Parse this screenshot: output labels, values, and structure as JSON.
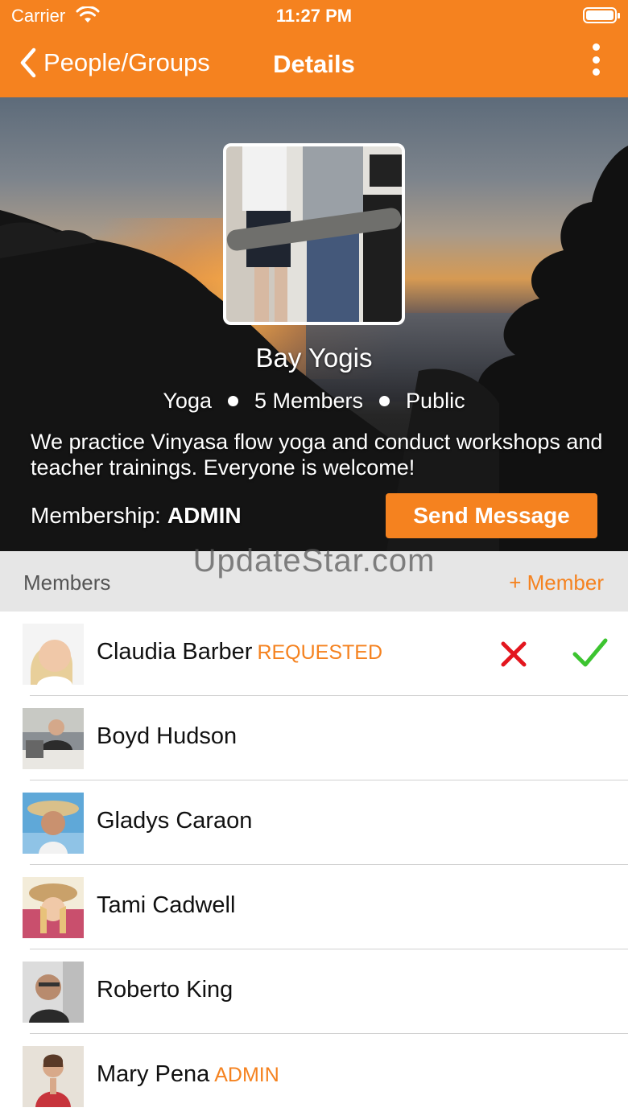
{
  "status_bar": {
    "carrier": "Carrier",
    "time": "11:27 PM",
    "wifi_icon": "wifi-icon",
    "battery_icon": "battery-icon"
  },
  "nav": {
    "back_label": "People/Groups",
    "title": "Details",
    "menu_icon": "more-vertical-icon"
  },
  "group": {
    "name": "Bay Yogis",
    "category": "Yoga",
    "members_count": "5 Members",
    "visibility": "Public",
    "description": "We practice Vinyasa flow yoga and conduct workshops and teacher trainings. Everyone is welcome!",
    "membership_label": "Membership:",
    "membership_role": "ADMIN",
    "send_message_label": "Send Message"
  },
  "members_section": {
    "title": "Members",
    "add_label": "+ Member"
  },
  "watermark": "UpdateStar.com",
  "members": [
    {
      "name": "Claudia Barber",
      "badge": "REQUESTED",
      "reject_icon": "x-icon",
      "accept_icon": "check-icon"
    },
    {
      "name": "Boyd Hudson",
      "badge": ""
    },
    {
      "name": "Gladys Caraon",
      "badge": ""
    },
    {
      "name": "Tami Cadwell",
      "badge": ""
    },
    {
      "name": "Roberto King",
      "badge": ""
    },
    {
      "name": "Mary Pena",
      "badge": "ADMIN"
    }
  ],
  "colors": {
    "accent": "#f5821f",
    "reject": "#e3161e",
    "accept": "#3cc430",
    "header_bg": "#e6e6e6"
  }
}
